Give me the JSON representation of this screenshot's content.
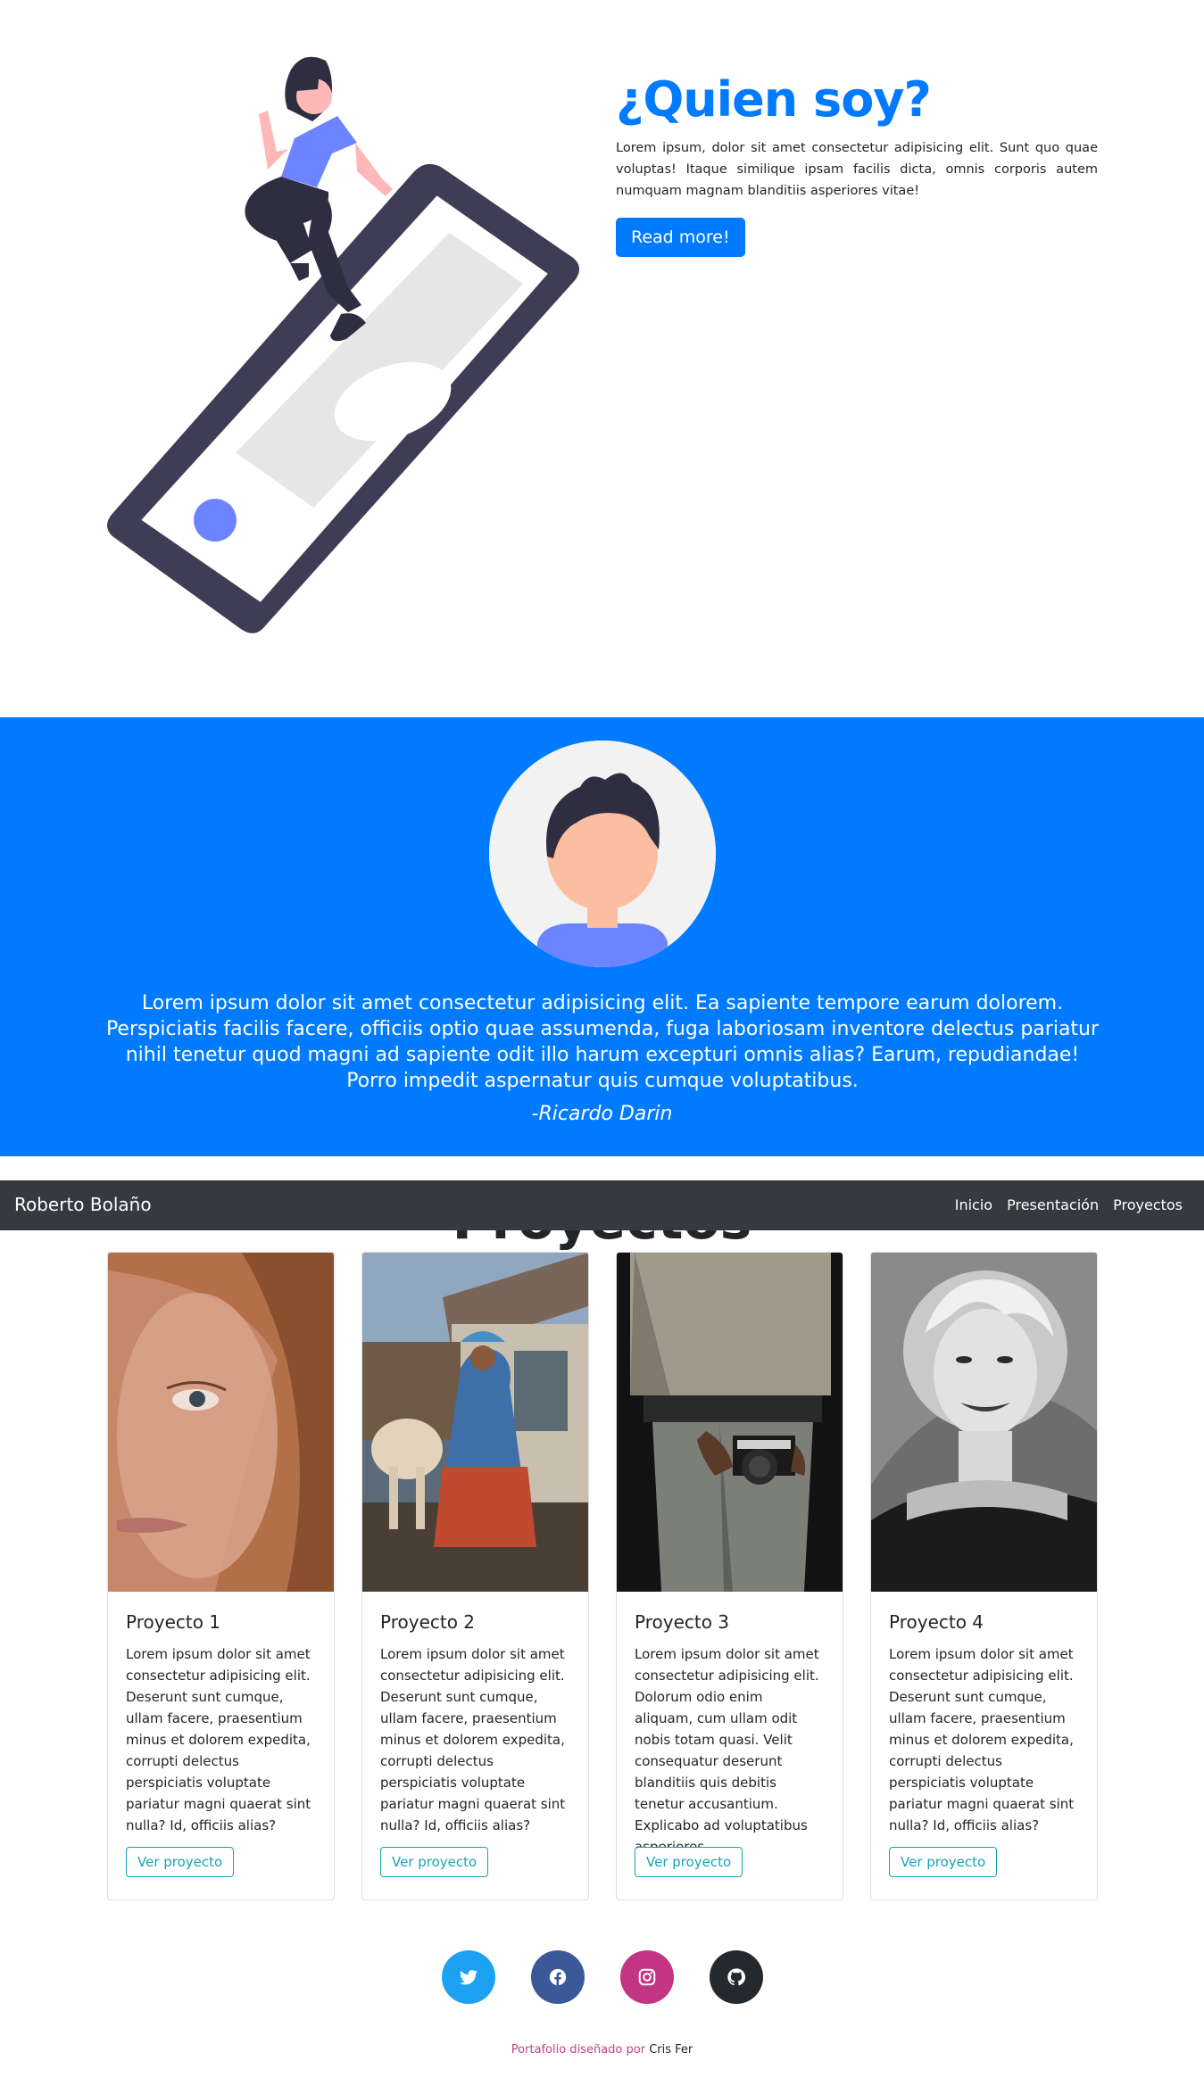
{
  "about": {
    "title": "¿Quien soy?",
    "description": "Lorem ipsum, dolor sit amet consectetur adipisicing elit. Sunt quo quae voluptas! Itaque similique ipsam facilis dicta, omnis corporis autem numquam magnam blanditiis asperiores vitae!",
    "button_label": "Read more!"
  },
  "testimonial": {
    "quote": "Lorem ipsum dolor sit amet consectetur adipisicing elit. Ea sapiente tempore earum dolorem. Perspiciatis facilis facere, officiis optio quae assumenda, fuga laboriosam inventore delectus pariatur nihil tenetur quod magni ad sapiente odit illo harum excepturi omnis alias? Earum, repudiandae! Porro impedit aspernatur quis cumque voluptatibus.",
    "author": "-Ricardo Darin"
  },
  "navbar": {
    "brand": "Roberto Bolaño",
    "links": [
      "Inicio",
      "Presentación",
      "Proyectos"
    ]
  },
  "projects": {
    "heading": "Proyectos",
    "cards": [
      {
        "title": "Proyecto 1",
        "text": "Lorem ipsum dolor sit amet consectetur adipisicing elit. Deserunt sunt cumque, ullam facere, praesentium minus et dolorem expedita, corrupti delectus perspiciatis voluptate pariatur magni quaerat sint nulla? Id, officiis alias?",
        "button": "Ver proyecto"
      },
      {
        "title": "Proyecto 2",
        "text": "Lorem ipsum dolor sit amet consectetur adipisicing elit. Deserunt sunt cumque, ullam facere, praesentium minus et dolorem expedita, corrupti delectus perspiciatis voluptate pariatur magni quaerat sint nulla? Id, officiis alias?",
        "button": "Ver proyecto"
      },
      {
        "title": "Proyecto 3",
        "text": "Lorem ipsum dolor sit amet consectetur adipisicing elit. Dolorum odio enim aliquam, cum ullam odit nobis totam quasi. Velit consequatur deserunt blanditiis quis debitis tenetur accusantium. Explicabo ad voluptatibus asperiores.",
        "button": "Ver proyecto"
      },
      {
        "title": "Proyecto 4",
        "text": "Lorem ipsum dolor sit amet consectetur adipisicing elit. Deserunt sunt cumque, ullam facere, praesentium minus et dolorem expedita, corrupti delectus perspiciatis voluptate pariatur magni quaerat sint nulla? Id, officiis alias?",
        "button": "Ver proyecto"
      }
    ]
  },
  "social": [
    {
      "icon": "twitter-icon",
      "color": "#1da1f2"
    },
    {
      "icon": "facebook-icon",
      "color": "#3b5998"
    },
    {
      "icon": "instagram-icon",
      "color": "#c13584"
    },
    {
      "icon": "github-icon",
      "color": "#24292e"
    }
  ],
  "footer": {
    "designed_by": "Portafolio diseñado por",
    "author": "Cris Fer"
  },
  "colors": {
    "primary": "#007bff",
    "navbar": "#343a40",
    "info": "#17a2b8"
  }
}
